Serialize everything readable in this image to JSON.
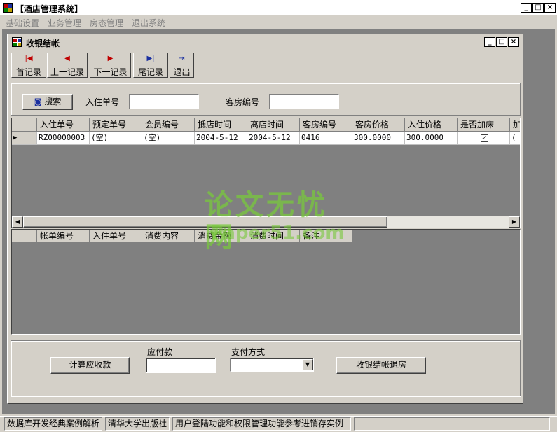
{
  "app": {
    "title": "【酒店管理系统】",
    "menu": [
      "基础设置",
      "业务管理",
      "房态管理",
      "退出系统"
    ]
  },
  "child": {
    "title": "收银结帐",
    "toolbar": [
      {
        "label": "首记录",
        "icon": "first-record-icon",
        "glyph": "|◀"
      },
      {
        "label": "上一记录",
        "icon": "prev-record-icon",
        "glyph": "◀"
      },
      {
        "label": "下一记录",
        "icon": "next-record-icon",
        "glyph": "▶"
      },
      {
        "label": "尾记录",
        "icon": "last-record-icon",
        "glyph": "▶|"
      },
      {
        "label": "退出",
        "icon": "exit-icon",
        "glyph": "⇥"
      }
    ],
    "search": {
      "button_label": "搜索",
      "checkin_label": "入住单号",
      "checkin_value": "",
      "room_label": "客房编号",
      "room_value": ""
    },
    "grid1": {
      "columns": [
        "入住单号",
        "预定单号",
        "会员编号",
        "抵店时间",
        "离店时间",
        "客房编号",
        "客房价格",
        "入住价格",
        "是否加床",
        "加"
      ],
      "row": [
        "RZ00000003",
        "(空)",
        "(空)",
        "2004-5-12",
        "2004-5-12",
        "0416",
        "300.0000",
        "300.0000",
        "✓",
        "("
      ]
    },
    "grid2": {
      "columns": [
        "帐单编号",
        "入住单号",
        "消费内容",
        "消费金额",
        "消费时间",
        "备注"
      ]
    },
    "footer": {
      "calc_button": "计算应收款",
      "payable_label": "应付款",
      "payable_value": "",
      "pay_method_label": "支付方式",
      "pay_method_value": "",
      "checkout_button": "收银结帐退房"
    }
  },
  "watermark": {
    "line1": "论文无忧网",
    "line2": "Paper51.com"
  },
  "status": {
    "panels": [
      "数据库开发经典案例解析",
      "清华大学出版社",
      "用户登陆功能和权限管理功能参考进销存实例",
      ""
    ]
  },
  "colors": {
    "face": "#d4d0c8",
    "mdi_background": "#808080",
    "watermark_green": "#78c83c",
    "nav_red": "#c00000",
    "nav_blue": "#1a2fa0"
  }
}
